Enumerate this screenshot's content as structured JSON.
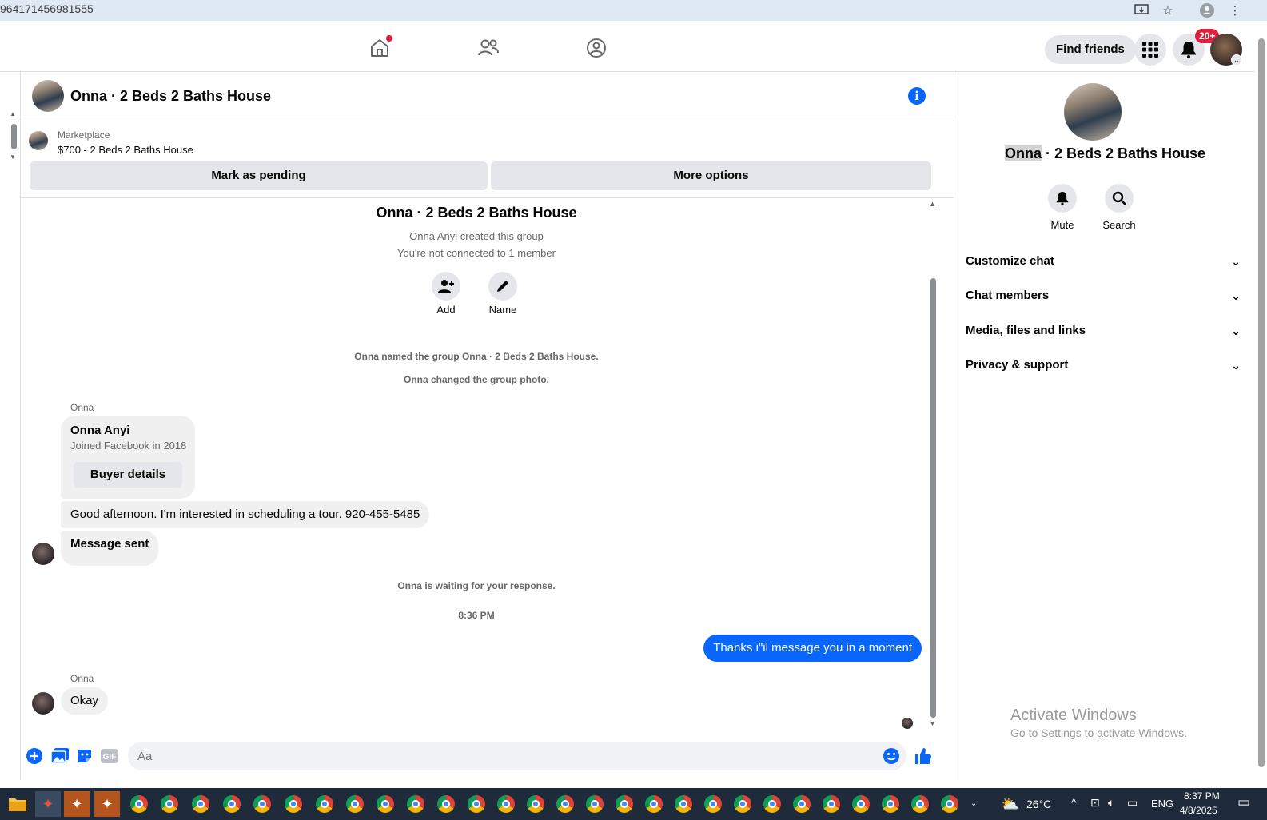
{
  "browser": {
    "url_fragment": "964171456981555"
  },
  "nav": {
    "find_friends": "Find friends",
    "notification_count": "20+"
  },
  "chat": {
    "title": "Onna · 2 Beds 2 Baths House",
    "listing": {
      "source": "Marketplace",
      "price_line": "$700 - 2 Beds 2 Baths House"
    },
    "mark_pending": "Mark as pending",
    "more_options": "More options"
  },
  "intro": {
    "title": "Onna · 2 Beds 2 Baths House",
    "created": "Onna Anyi created this group",
    "not_connected": "You're not connected to 1 member",
    "add_label": "Add",
    "name_label": "Name",
    "event_named": "Onna named the group Onna · 2 Beds 2 Baths House.",
    "event_photo": "Onna changed the group photo."
  },
  "messages": {
    "sender_1": "Onna",
    "buyer_name": "Onna Anyi",
    "buyer_joined": "Joined Facebook in 2018",
    "buyer_details": "Buyer details",
    "msg_interest": "Good afternoon. I'm interested in scheduling a tour. 920-455-5485",
    "msg_sent": "Message sent",
    "waiting": "Onna is waiting for your response.",
    "time": "8:36 PM",
    "msg_outgoing": "Thanks i\"il message you in a moment",
    "sender_2": "Onna",
    "msg_okay": "Okay"
  },
  "composer": {
    "placeholder": "Aa"
  },
  "panel": {
    "title_highlight": "Onna",
    "title_rest": " · 2 Beds 2 Baths House",
    "mute": "Mute",
    "search": "Search",
    "rows": [
      "Customize chat",
      "Chat members",
      "Media, files and links",
      "Privacy & support"
    ]
  },
  "watermark": {
    "line1": "Activate Windows",
    "line2": "Go to Settings to activate Windows."
  },
  "taskbar": {
    "temperature": "26°C",
    "language": "ENG",
    "time": "8:37 PM",
    "date": "4/8/2025"
  },
  "colors": {
    "accent": "#0866ff",
    "badge": "#e41e3f",
    "bubble_in": "#f0f0f0"
  }
}
